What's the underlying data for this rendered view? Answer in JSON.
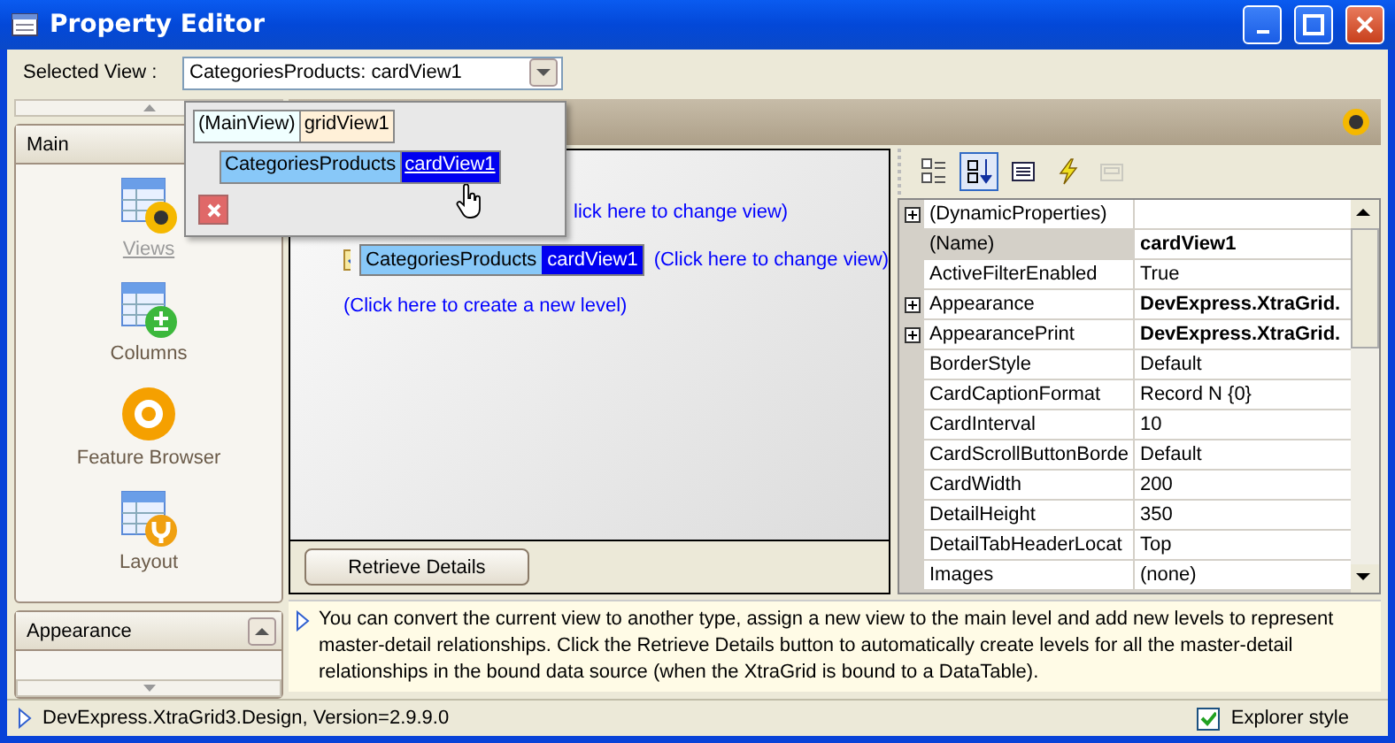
{
  "window": {
    "title": "Property Editor"
  },
  "selected_view": {
    "label": "Selected View :",
    "value": "CategoriesProducts: cardView1"
  },
  "view_dropdown": {
    "levels": [
      {
        "relation": "(MainView)",
        "view": "gridView1",
        "selected": false,
        "children": [
          {
            "relation": "CategoriesProducts",
            "view": "cardView1",
            "selected": true
          }
        ]
      }
    ]
  },
  "sidebar": {
    "groups": [
      {
        "title": "Main",
        "items": [
          {
            "label": "Views",
            "kind": "views",
            "selected": true
          },
          {
            "label": "Columns",
            "kind": "columns",
            "selected": false
          },
          {
            "label": "Feature Browser",
            "kind": "features",
            "selected": false
          },
          {
            "label": "Layout",
            "kind": "layout",
            "selected": false
          }
        ]
      },
      {
        "title": "Appearance"
      }
    ]
  },
  "level_tree": {
    "rows": [
      {
        "link": "lick here to change view)"
      },
      {
        "relation": "CategoriesProducts",
        "view": "cardView1",
        "link": "(Click here to change view)"
      }
    ],
    "new_level_link": "(Click here to create a new level)",
    "button": "Retrieve Details"
  },
  "property_grid": {
    "toolbar": [
      {
        "kind": "categorized",
        "selected": false,
        "disabled": false
      },
      {
        "kind": "alphabetical",
        "selected": true,
        "disabled": false
      },
      {
        "kind": "properties",
        "selected": false,
        "disabled": false
      },
      {
        "kind": "events",
        "selected": false,
        "disabled": false
      },
      {
        "kind": "pages",
        "selected": false,
        "disabled": true
      }
    ],
    "rows": [
      {
        "name": "(DynamicProperties)",
        "expandable": true,
        "selected": false
      },
      {
        "name": "(Name)",
        "value": "cardView1",
        "expandable": false,
        "bold": true,
        "selected": true
      },
      {
        "name": "ActiveFilterEnabled",
        "value": "True",
        "expandable": false,
        "bold": false,
        "selected": false
      },
      {
        "name": "Appearance",
        "value": "DevExpress.XtraGrid.",
        "expandable": true,
        "bold": true,
        "selected": false
      },
      {
        "name": "AppearancePrint",
        "value": "DevExpress.XtraGrid.",
        "expandable": true,
        "bold": true,
        "selected": false
      },
      {
        "name": "BorderStyle",
        "value": "Default",
        "expandable": false,
        "bold": false,
        "selected": false
      },
      {
        "name": "CardCaptionFormat",
        "value": "Record N {0}",
        "expandable": false,
        "bold": false,
        "selected": false
      },
      {
        "name": "CardInterval",
        "value": "10",
        "expandable": false,
        "bold": false,
        "selected": false
      },
      {
        "name": "CardScrollButtonBorde",
        "value": "Default",
        "expandable": false,
        "bold": false,
        "selected": false
      },
      {
        "name": "CardWidth",
        "value": "200",
        "expandable": false,
        "bold": false,
        "selected": false
      },
      {
        "name": "DetailHeight",
        "value": "350",
        "expandable": false,
        "bold": false,
        "selected": false
      },
      {
        "name": "DetailTabHeaderLocat",
        "value": "Top",
        "expandable": false,
        "bold": false,
        "selected": false
      },
      {
        "name": "Images",
        "value": "(none)",
        "expandable": false,
        "bold": false,
        "selected": false
      }
    ]
  },
  "description": "You can convert the current view to another type, assign a new view to the main level and add new levels to represent master-detail relationships. Click the Retrieve Details button to automatically create levels for all the master-detail relationships in the bound data source (when the XtraGrid is bound to a DataTable).",
  "status_bar": {
    "text": "DevExpress.XtraGrid3.Design, Version=2.9.9.0",
    "explorer_style": {
      "label": "Explorer style",
      "checked": true
    }
  }
}
